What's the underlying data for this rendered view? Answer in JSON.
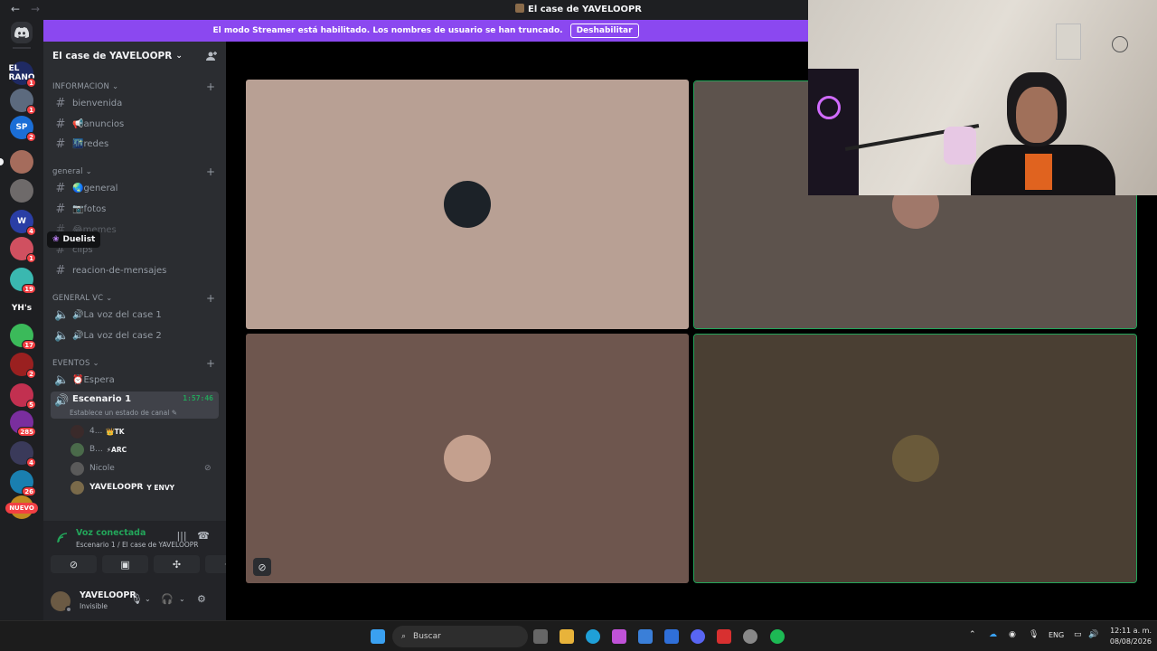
{
  "window": {
    "title": "El case de YAVELOOPR",
    "back": "←",
    "forward": "→"
  },
  "streamer_banner": {
    "message": "El modo Streamer está habilitado. Los nombres de usuario se han truncado.",
    "button": "Deshabilitar"
  },
  "server": {
    "name": "El case de YAVELOOPR"
  },
  "rail": {
    "servers": [
      {
        "label": "EL RANO",
        "badge": "1",
        "color": "#1f2a63"
      },
      {
        "label": "",
        "badge": "1",
        "color": "#5c6a7e"
      },
      {
        "label": "SP",
        "badge": "2",
        "color": "#1b6ed6"
      },
      {
        "label": "",
        "badge": "",
        "color": "#a56c5c"
      },
      {
        "label": "",
        "badge": "",
        "color": "#6e6a6a"
      },
      {
        "label": "W",
        "badge": "4",
        "color": "#2a3ea5"
      },
      {
        "label": "",
        "badge": "1",
        "color": "#d05060"
      },
      {
        "label": "",
        "badge": "19",
        "color": "#3ab8b0"
      },
      {
        "label": "YH's",
        "badge": "",
        "color": "#1e1f22"
      },
      {
        "label": "",
        "badge": "17",
        "color": "#3bba5a"
      },
      {
        "label": "",
        "badge": "2",
        "color": "#9a2020"
      },
      {
        "label": "",
        "badge": "5",
        "color": "#c23050"
      },
      {
        "label": "",
        "badge": "285",
        "color": "#7a2e9e"
      },
      {
        "label": "",
        "badge": "4",
        "color": "#3a3a5a"
      },
      {
        "label": "",
        "badge": "26",
        "color": "#1a7fb0"
      },
      {
        "label": "",
        "badge": "",
        "color": "#c08a20"
      }
    ],
    "nuevo": "NUEVO"
  },
  "categories": {
    "informacion": "INFORMACION",
    "general": "general",
    "general_vc": "GENERAL VC",
    "eventos": "EVENTOS"
  },
  "channels": {
    "bienvenida": "bienvenida",
    "anuncios": "📢anuncios",
    "redes": "🌃redes",
    "general": "🌏general",
    "fotos": "📷fotos",
    "memes": "😂memes",
    "clips": "clips",
    "reacion": "reacion-de-mensajes",
    "voz1": "🔊La voz del case 1",
    "voz2": "🔊La voz del case 2",
    "espera": "⏰Espera",
    "escenario": "Escenario 1",
    "escenario_timer": "1:57:46",
    "escenario_status": "Establece un estado de canal"
  },
  "tooltip": "Duelist",
  "voice_users": [
    {
      "name": "4...",
      "tag": "👑TK",
      "color": "#3a2a2a"
    },
    {
      "name": "B...",
      "tag": "⚡ARC",
      "color": "#4a6a4a"
    },
    {
      "name": "Nicole",
      "tag": "",
      "color": "#5a5a5a"
    },
    {
      "name": "YAVELOOPR",
      "tag": "Y ENVY",
      "color": "#7a6a4a"
    }
  ],
  "voice_panel": {
    "status": "Voz conectada",
    "location": "Escenario 1 / El case de YAVELOOPR"
  },
  "user": {
    "name": "YAVELOOPR",
    "status": "Invisible"
  },
  "tiles": [
    {
      "bg": "#b8a094",
      "avatar": "#1c2228",
      "speaking": false
    },
    {
      "bg": "#5d534d",
      "avatar": "#a0786a",
      "speaking": true
    },
    {
      "bg": "#6e564e",
      "avatar": "#c4a08e",
      "speaking": false
    },
    {
      "bg": "#4a3f33",
      "avatar": "#6a5a3a",
      "speaking": true
    }
  ],
  "taskbar": {
    "search": "Buscar",
    "lang": "ENG",
    "time": "12:11 a. m.",
    "date": "08/08/2026"
  }
}
